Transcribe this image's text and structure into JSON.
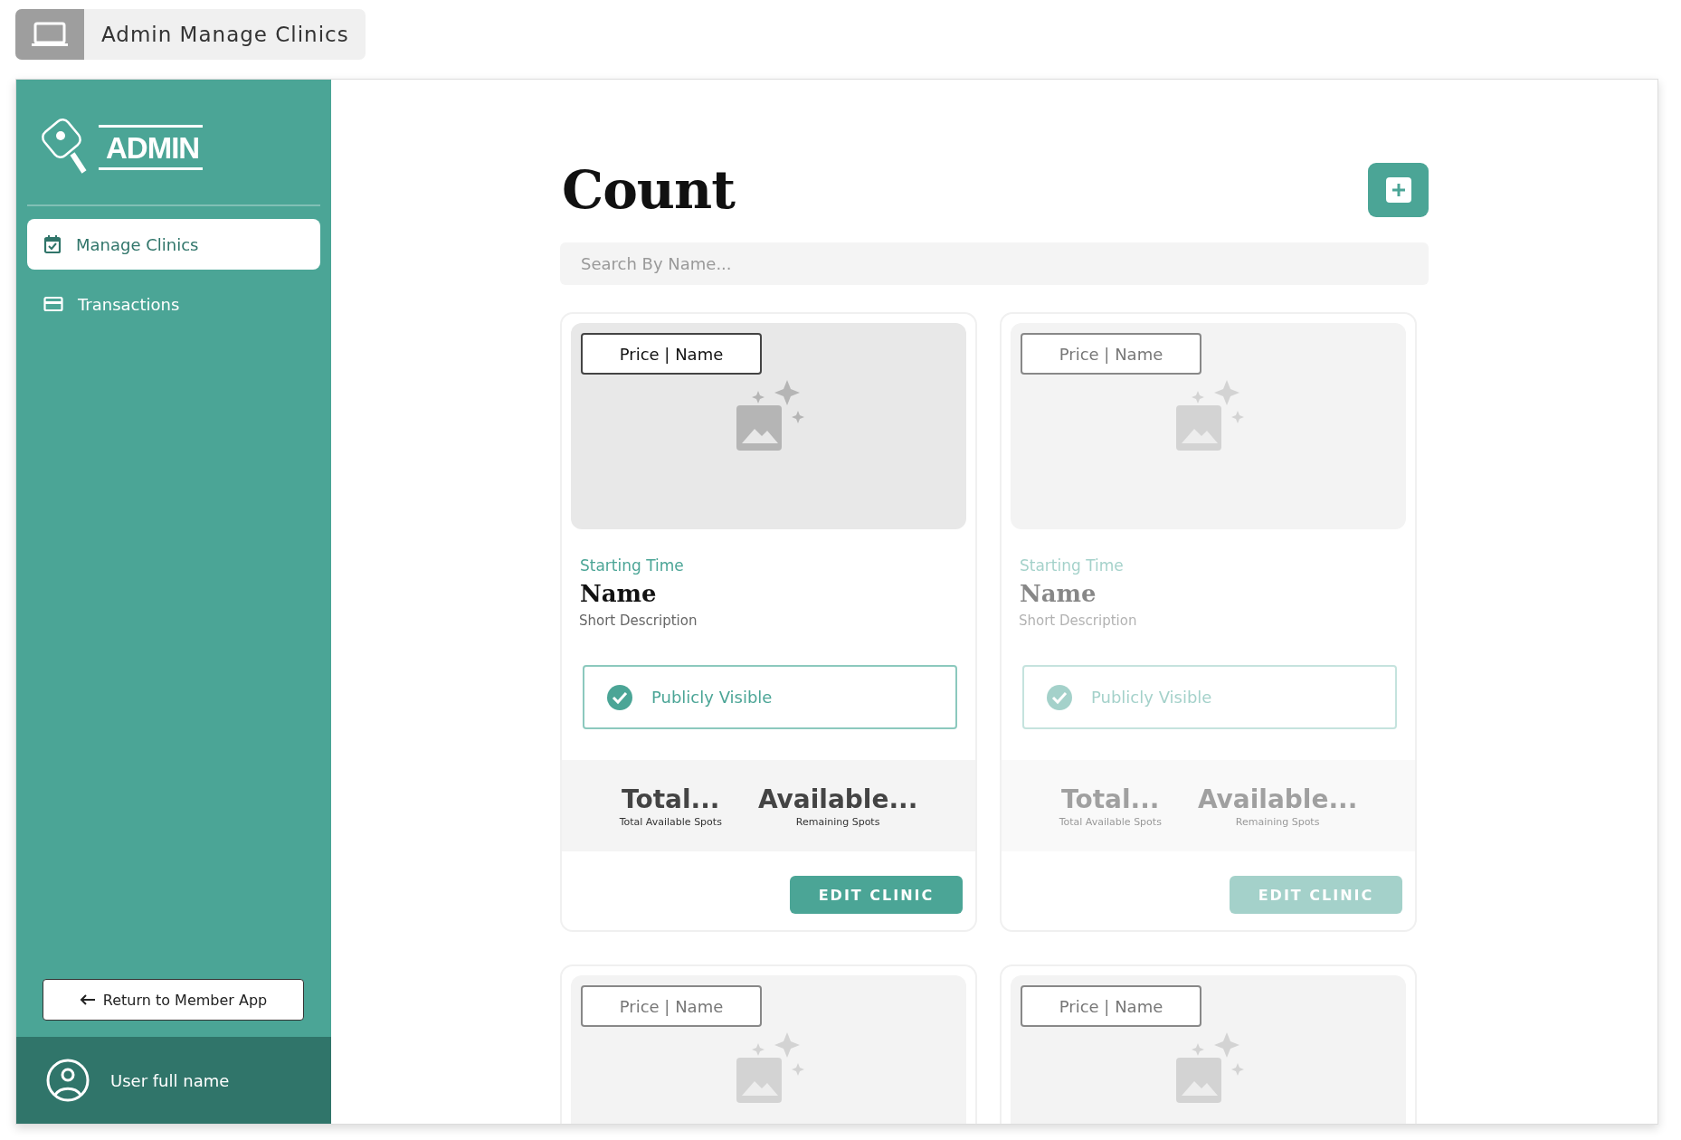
{
  "header": {
    "title": "Admin Manage Clinics"
  },
  "sidebar": {
    "logo_text": "ADMIN",
    "items": [
      {
        "label": "Manage Clinics",
        "kind": "calendar",
        "selected": true
      },
      {
        "label": "Transactions",
        "kind": "card",
        "selected": false
      }
    ],
    "return_button": "Return to Member App",
    "user": {
      "name": "User full name"
    }
  },
  "main": {
    "title": "Count",
    "search": {
      "placeholder": "Search By Name..."
    },
    "cards": [
      {
        "disabled": false,
        "price_tag": "Price | Name",
        "starting_time": "Starting Time",
        "name": "Name",
        "description": "Short Description",
        "visibility": {
          "label": "Publicly Visible",
          "checked": true
        },
        "stats": [
          {
            "value": "Total...",
            "label": "Total Available Spots"
          },
          {
            "value": "Available...",
            "label": "Remaining Spots"
          }
        ],
        "button": "EDIT CLINIC"
      },
      {
        "disabled": true,
        "price_tag": "Price | Name",
        "starting_time": "Starting Time",
        "name": "Name",
        "description": "Short Description",
        "visibility": {
          "label": "Publicly Visible",
          "checked": true
        },
        "stats": [
          {
            "value": "Total...",
            "label": "Total Available Spots"
          },
          {
            "value": "Available...",
            "label": "Remaining Spots"
          }
        ],
        "button": "EDIT CLINIC"
      },
      {
        "disabled": true,
        "price_tag": "Price | Name"
      },
      {
        "disabled": true,
        "price_tag": "Price | Name"
      }
    ]
  }
}
